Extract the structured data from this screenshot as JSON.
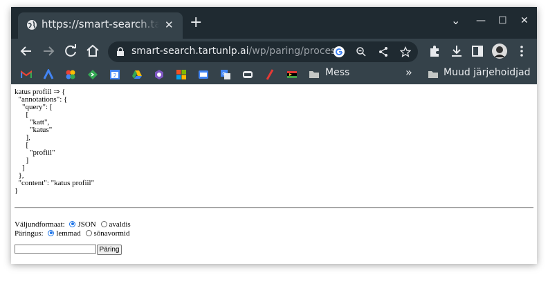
{
  "tab": {
    "title": "https://smart-search.tartunlp.ai/wp/paring/process",
    "close": "✕"
  },
  "newtab": "+",
  "window_controls": {
    "chevron": "⌄",
    "minimize": "—",
    "maximize": "☐",
    "close": "✕"
  },
  "address": {
    "host": "smart-search.tartunlp.ai",
    "path": "/wp/paring/process"
  },
  "bookmarks": {
    "overflow": "»",
    "folders": [
      "Mess",
      "Muud järjehoidjad"
    ]
  },
  "page": {
    "json_text": "katus profiil ⇒ {\n  \"annotations\": {\n    \"query\": [\n      [\n        \"katt\",\n        \"katus\"\n      ],\n      [\n        \"profiil\"\n      ]\n    ]\n  },\n  \"content\": \"katus profiil\"\n}",
    "output_format_label": "Väljundformaat:",
    "output_format_options": [
      "JSON",
      "avaldis"
    ],
    "output_format_selected": "JSON",
    "query_label": "Päringus:",
    "query_options": [
      "lemmad",
      "sõnavormid"
    ],
    "query_selected": "lemmad",
    "input_value": "",
    "submit_label": "Päring"
  },
  "colors": {
    "titlebar": "#1f2a31",
    "toolbar": "#35424a",
    "accent": "#1a73e8"
  }
}
